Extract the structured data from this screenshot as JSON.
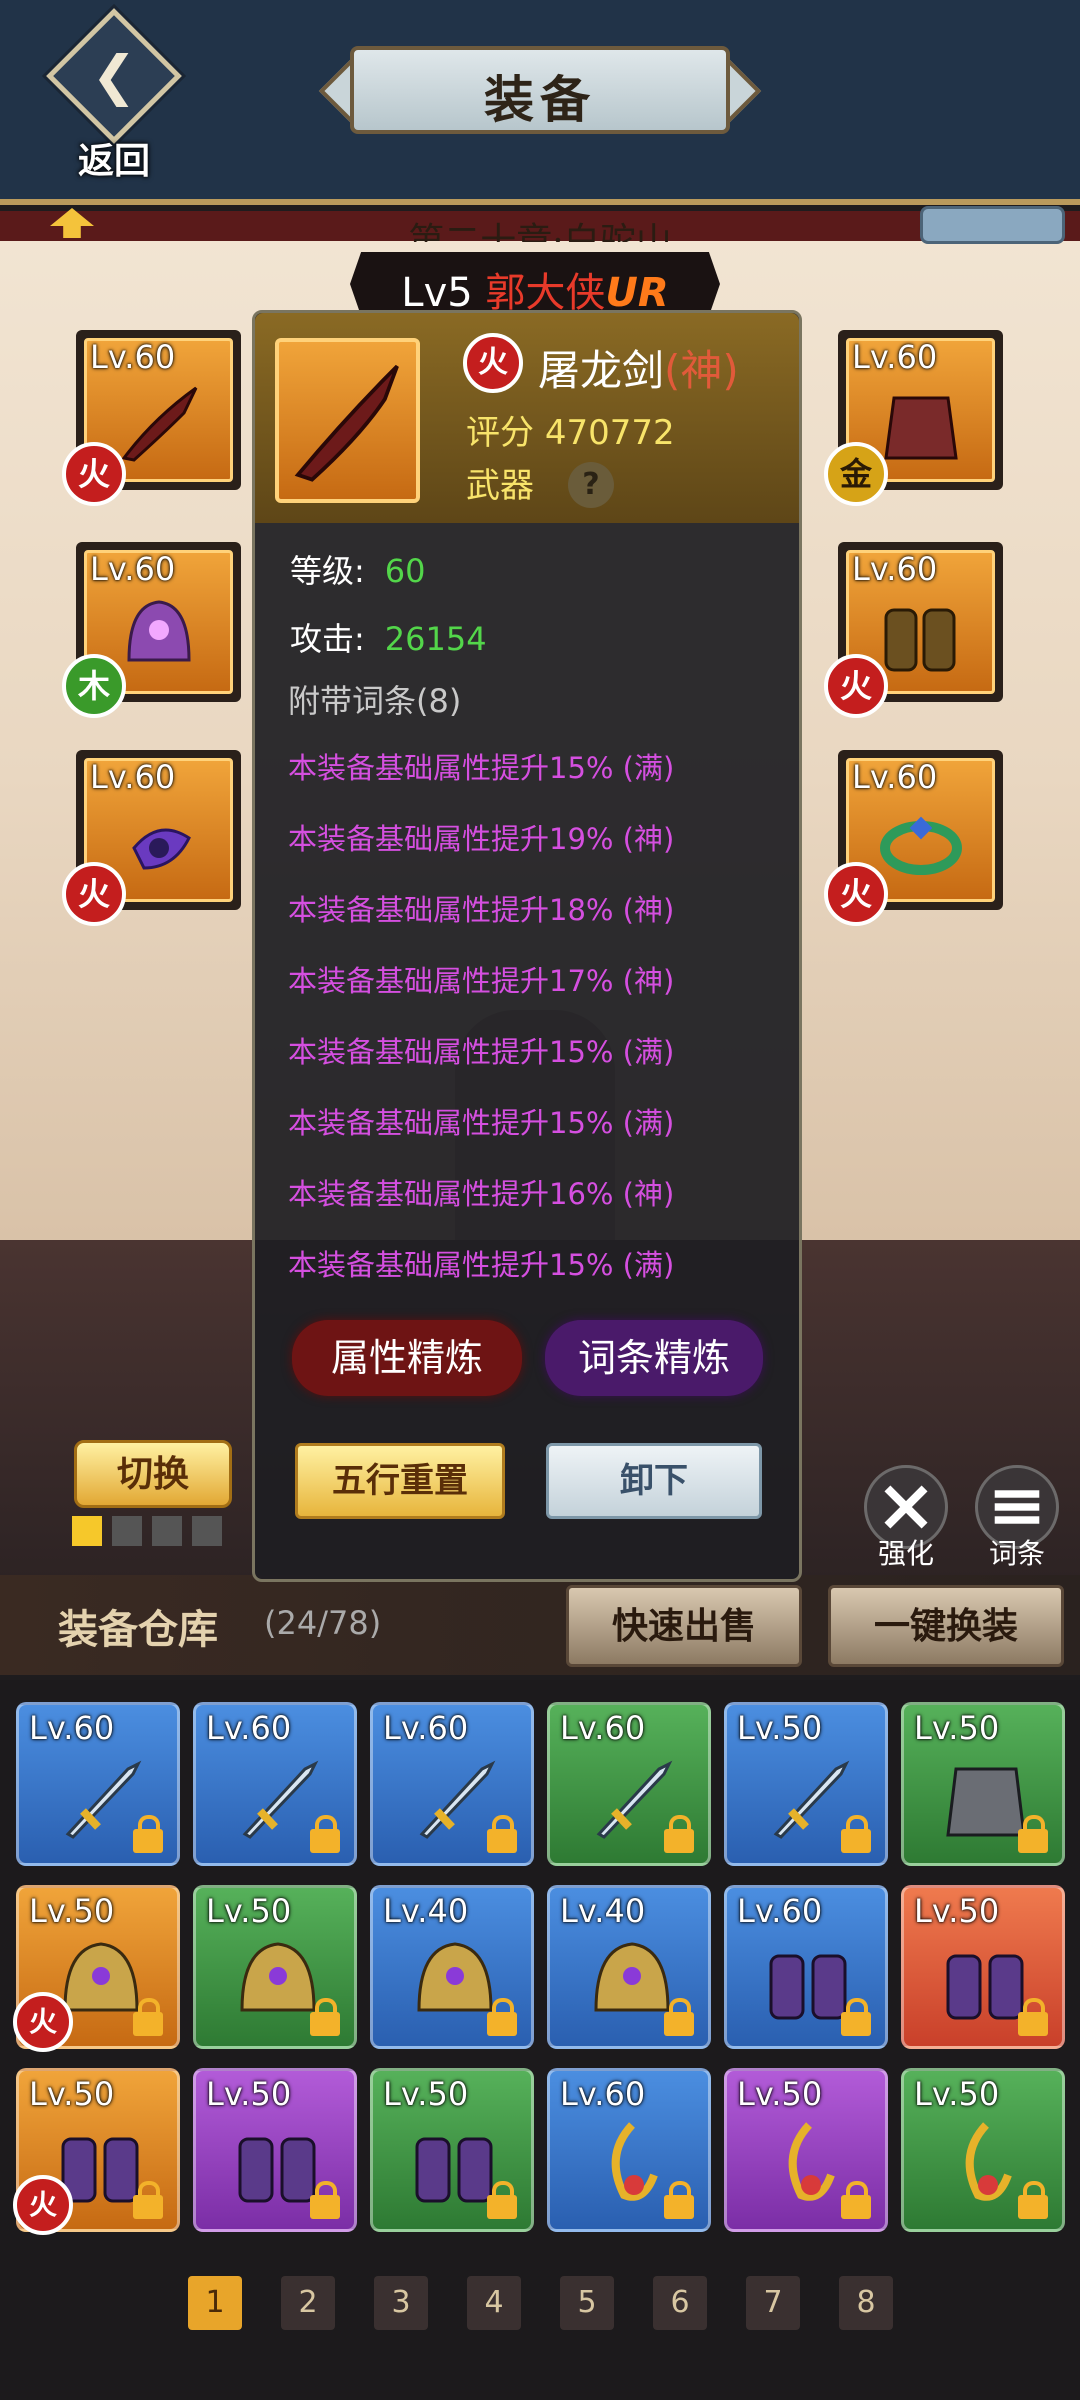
{
  "header": {
    "back_label": "返回",
    "title": "装备",
    "chapter": "第二十章·白驼山"
  },
  "hero": {
    "level": "Lv5",
    "name": "郭大侠",
    "rarity": "UR"
  },
  "slots": [
    {
      "level": "Lv.60",
      "element": "火",
      "elem_class": "fire",
      "icon": "dragon-sword-icon"
    },
    {
      "level": "Lv.60",
      "element": "木",
      "elem_class": "wood",
      "icon": "helmet-icon"
    },
    {
      "level": "Lv.60",
      "element": "火",
      "elem_class": "fire",
      "icon": "amulet-icon"
    },
    {
      "level": "Lv.60",
      "element": "金",
      "elem_class": "gold",
      "icon": "armor-icon"
    },
    {
      "level": "Lv.60",
      "element": "火",
      "elem_class": "fire",
      "icon": "boots-icon"
    },
    {
      "level": "Lv.60",
      "element": "火",
      "elem_class": "fire",
      "icon": "ring-icon"
    }
  ],
  "popup": {
    "element": "火",
    "name": "屠龙剑",
    "grade": "(神)",
    "score_label": "评分",
    "score": "470772",
    "type": "武器",
    "help": "?",
    "level_label": "等级:",
    "level": "60",
    "atk_label": "攻击:",
    "atk": "26154",
    "affix_header": "附带词条(8)",
    "affixes": [
      "本装备基础属性提升15% (满)",
      "本装备基础属性提升19% (神)",
      "本装备基础属性提升18% (神)",
      "本装备基础属性提升17% (神)",
      "本装备基础属性提升15% (满)",
      "本装备基础属性提升15% (满)",
      "本装备基础属性提升16% (神)",
      "本装备基础属性提升15% (满)"
    ],
    "btn_attr_refine": "属性精炼",
    "btn_affix_refine": "词条精炼",
    "btn_reset": "五行重置",
    "btn_unequip": "卸下"
  },
  "switch_label": "切换",
  "tools": {
    "strengthen": "强化",
    "affix": "词条"
  },
  "warehouse": {
    "title": "装备仓库",
    "count": "(24/78)",
    "quick_sell": "快速出售",
    "one_click": "一键换装"
  },
  "items": [
    {
      "level": "Lv.60",
      "color": "c-blue",
      "icon": "sword-icon"
    },
    {
      "level": "Lv.60",
      "color": "c-blue",
      "icon": "sword-icon"
    },
    {
      "level": "Lv.60",
      "color": "c-blue",
      "icon": "sword-icon"
    },
    {
      "level": "Lv.60",
      "color": "c-green",
      "icon": "sword-icon"
    },
    {
      "level": "Lv.50",
      "color": "c-blue",
      "icon": "sword-icon"
    },
    {
      "level": "Lv.50",
      "color": "c-green",
      "icon": "armor-icon"
    },
    {
      "level": "Lv.50",
      "color": "c-orange",
      "icon": "helmet-icon",
      "element": "火"
    },
    {
      "level": "Lv.50",
      "color": "c-green",
      "icon": "helmet-icon"
    },
    {
      "level": "Lv.40",
      "color": "c-blue",
      "icon": "helmet-icon"
    },
    {
      "level": "Lv.40",
      "color": "c-blue",
      "icon": "helmet-icon"
    },
    {
      "level": "Lv.60",
      "color": "c-blue",
      "icon": "boots-icon"
    },
    {
      "level": "Lv.50",
      "color": "c-red",
      "icon": "boots-icon"
    },
    {
      "level": "Lv.50",
      "color": "c-orange",
      "icon": "boots-icon",
      "element": "火"
    },
    {
      "level": "Lv.50",
      "color": "c-purple",
      "icon": "boots-icon"
    },
    {
      "level": "Lv.50",
      "color": "c-green",
      "icon": "boots-icon"
    },
    {
      "level": "Lv.60",
      "color": "c-blue",
      "icon": "amulet-icon"
    },
    {
      "level": "Lv.50",
      "color": "c-purple",
      "icon": "amulet-icon"
    },
    {
      "level": "Lv.50",
      "color": "c-green",
      "icon": "amulet-icon"
    }
  ],
  "pages": [
    "1",
    "2",
    "3",
    "4",
    "5",
    "6",
    "7",
    "8"
  ]
}
